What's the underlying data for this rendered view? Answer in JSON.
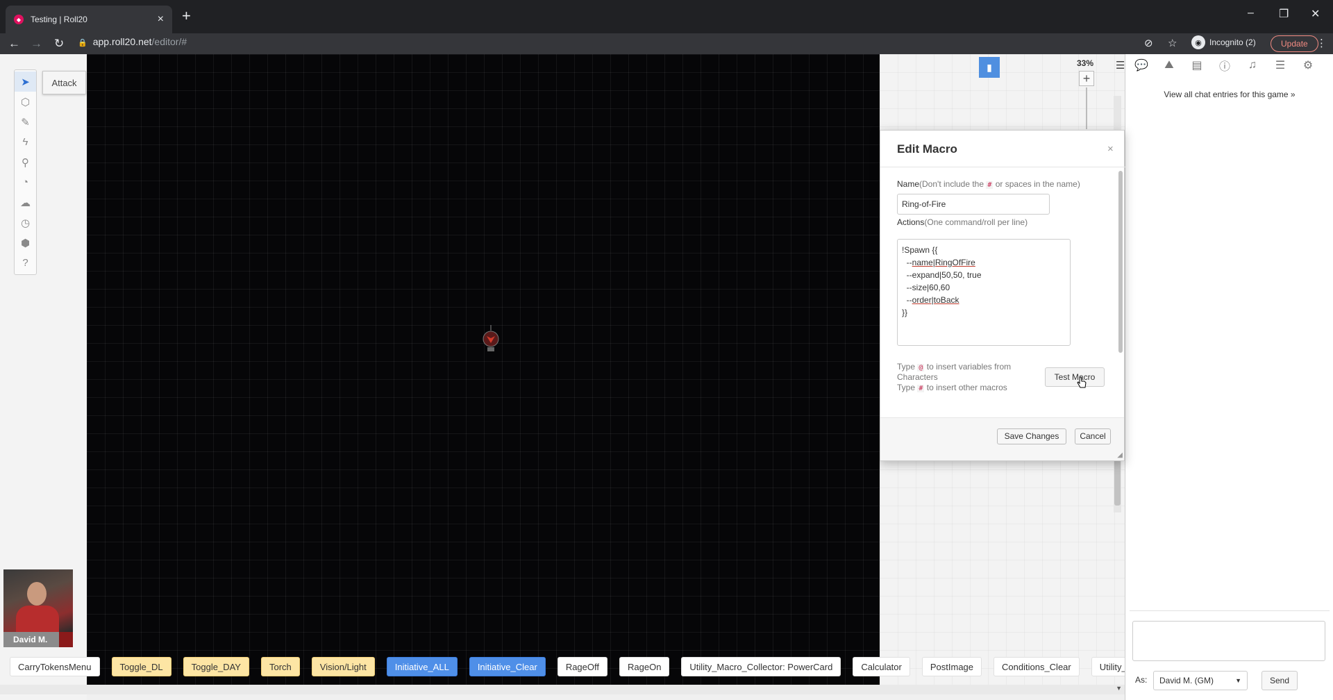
{
  "browser": {
    "tab_title": "Testing | Roll20",
    "url_host": "app.roll20.net",
    "url_path": "/editor/#",
    "incognito_label": "Incognito (2)",
    "update_label": "Update"
  },
  "toolbar": {
    "attack_label": "Attack",
    "tools": [
      "select-icon",
      "layers-icon",
      "draw-icon",
      "fx-icon",
      "zoom-icon",
      "measure-icon",
      "fog-icon",
      "turn-tracker-icon",
      "dice-icon",
      "help-icon"
    ]
  },
  "map": {
    "zoom_label": "33%"
  },
  "player": {
    "name": "David M."
  },
  "macro_bar": [
    {
      "label": "CarryTokensMenu",
      "style": "white"
    },
    {
      "label": "Toggle_DL",
      "style": "yellow"
    },
    {
      "label": "Toggle_DAY",
      "style": "yellow"
    },
    {
      "label": "Torch",
      "style": "yellow"
    },
    {
      "label": "Vision/Light",
      "style": "yellow"
    },
    {
      "label": "Initiative_ALL",
      "style": "blue"
    },
    {
      "label": "Initiative_Clear",
      "style": "blue"
    },
    {
      "label": "RageOff",
      "style": "white"
    },
    {
      "label": "RageOn",
      "style": "white"
    },
    {
      "label": "Utility_Macro_Collector: PowerCard",
      "style": "white"
    },
    {
      "label": "Calculator",
      "style": "white"
    },
    {
      "label": "PostImage",
      "style": "white"
    },
    {
      "label": "Conditions_Clear",
      "style": "white"
    },
    {
      "label": "Utility_Macro_C",
      "style": "white"
    }
  ],
  "sidebar": {
    "view_all_link": "View all chat entries for this game »",
    "as_label": "As:",
    "as_value": "David M. (GM)",
    "send_label": "Send"
  },
  "dialog": {
    "title": "Edit Macro",
    "close": "×",
    "name_label": "Name",
    "name_hint_pre": "(Don't include the",
    "name_hint_code": "#",
    "name_hint_post": "or spaces in the name)",
    "name_value": "Ring-of-Fire",
    "actions_label": "Actions",
    "actions_hint": "(One command/roll per line)",
    "actions_lines": {
      "l1": "!Spawn {{",
      "l2_pre": "  --",
      "l2_u1": "name",
      "l2_mid": "|",
      "l2_u2": "RingOfFire",
      "l3": "  --expand|50,50, true",
      "l4": "  --size|60,60",
      "l5_pre": "  --",
      "l5_u": "order|toBack",
      "l6": "}}"
    },
    "tip1_pre": "Type",
    "tip1_code": "@",
    "tip1_post": "to insert variables from",
    "tip1_cont": "Characters",
    "tip2_pre": "Type",
    "tip2_code": "#",
    "tip2_post": "to insert other macros",
    "test_label": "Test Macro",
    "save_label": "Save Changes",
    "cancel_label": "Cancel"
  }
}
